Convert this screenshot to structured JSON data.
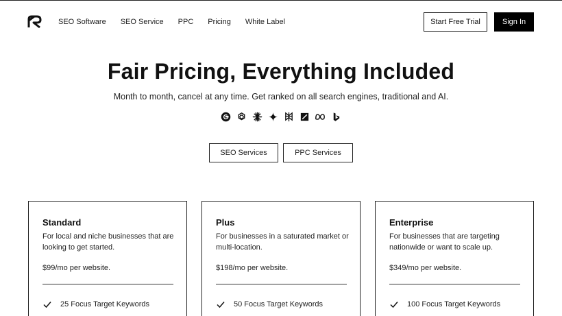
{
  "header": {
    "logo": "logo-icon",
    "nav": [
      "SEO Software",
      "SEO Service",
      "PPC",
      "Pricing",
      "White Label"
    ],
    "trial_label": "Start Free Trial",
    "signin_label": "Sign In"
  },
  "hero": {
    "title": "Fair Pricing, Everything Included",
    "subtitle": "Month to month, cancel at any time. Get ranked on all search engines, traditional and AI.",
    "engines": [
      "google-icon",
      "chatgpt-icon",
      "claude-icon",
      "gemini-icon",
      "perplexity-icon",
      "grok-icon",
      "meta-icon",
      "bing-icon"
    ]
  },
  "services": {
    "seo_label": "SEO Services",
    "ppc_label": "PPC Services"
  },
  "plans": [
    {
      "name": "Standard",
      "description": "For local and niche businesses that are looking to get started.",
      "price": "$99/mo per website.",
      "feature": "25 Focus Target Keywords"
    },
    {
      "name": "Plus",
      "description": "For businesses in a saturated market or multi-location.",
      "price": "$198/mo per website.",
      "feature": "50 Focus Target Keywords"
    },
    {
      "name": "Enterprise",
      "description": "For businesses that are targeting nationwide or want to scale up.",
      "price": "$349/mo per website.",
      "feature": "100 Focus Target Keywords"
    }
  ]
}
